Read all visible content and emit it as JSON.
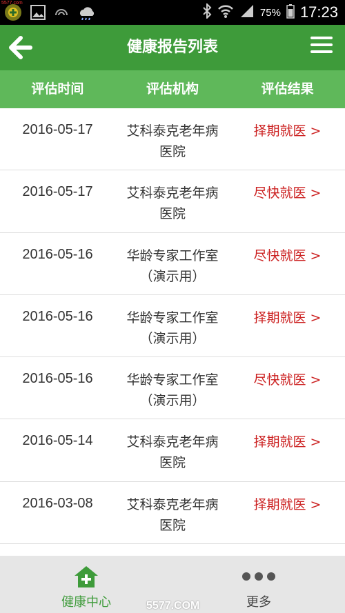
{
  "status_bar": {
    "watermark": "5577.com",
    "battery": "75%",
    "time": "17:23"
  },
  "header": {
    "title": "健康报告列表"
  },
  "columns": [
    "评估时间",
    "评估机构",
    "评估结果"
  ],
  "rows": [
    {
      "date": "2016-05-17",
      "org_line1": "艾科泰克老年病",
      "org_line2": "医院",
      "result": "择期就医 >"
    },
    {
      "date": "2016-05-17",
      "org_line1": "艾科泰克老年病",
      "org_line2": "医院",
      "result": "尽快就医 >"
    },
    {
      "date": "2016-05-16",
      "org_line1": "华龄专家工作室",
      "org_line2": "（演示用）",
      "result": "尽快就医 >"
    },
    {
      "date": "2016-05-16",
      "org_line1": "华龄专家工作室",
      "org_line2": "（演示用）",
      "result": "择期就医 >"
    },
    {
      "date": "2016-05-16",
      "org_line1": "华龄专家工作室",
      "org_line2": "（演示用）",
      "result": "尽快就医 >"
    },
    {
      "date": "2016-05-14",
      "org_line1": "艾科泰克老年病",
      "org_line2": "医院",
      "result": "择期就医 >"
    },
    {
      "date": "2016-03-08",
      "org_line1": "艾科泰克老年病",
      "org_line2": "医院",
      "result": "择期就医 >"
    }
  ],
  "bottom_nav": {
    "items": [
      {
        "label": "健康中心",
        "icon": "house-plus-icon",
        "active": true
      },
      {
        "label": "更多",
        "icon": "more-dots-icon",
        "active": false
      }
    ]
  },
  "footer_watermark": "5577.COM",
  "colors": {
    "header_green": "#3e9b3a",
    "column_header_green": "#5fb85a",
    "result_red": "#cc2222",
    "nav_bg": "#e6e6e6"
  }
}
